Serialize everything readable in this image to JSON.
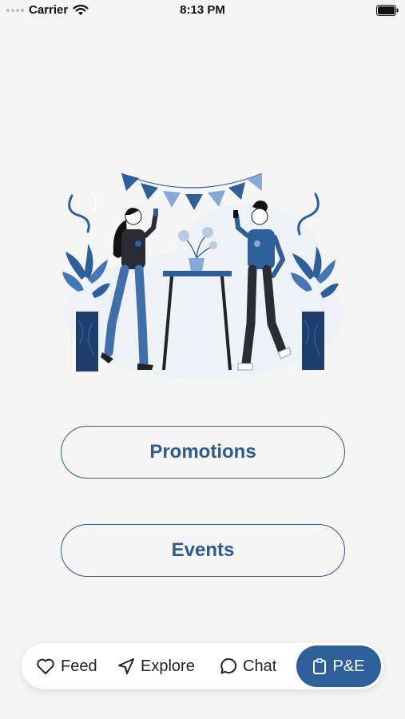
{
  "status_bar": {
    "carrier": "Carrier",
    "time": "8:13 PM"
  },
  "main": {
    "promotions_label": "Promotions",
    "events_label": "Events"
  },
  "tab_bar": {
    "tabs": [
      {
        "label": "Feed",
        "icon": "heart-icon",
        "active": false
      },
      {
        "label": "Explore",
        "icon": "navigation-arrow-icon",
        "active": false
      },
      {
        "label": "Chat",
        "icon": "chat-bubble-icon",
        "active": false
      },
      {
        "label": "P&E",
        "icon": "clipboard-icon",
        "active": true
      }
    ]
  },
  "colors": {
    "accent": "#2e5f98",
    "background": "#f5f5f5",
    "button_text": "#2e5a8c"
  }
}
